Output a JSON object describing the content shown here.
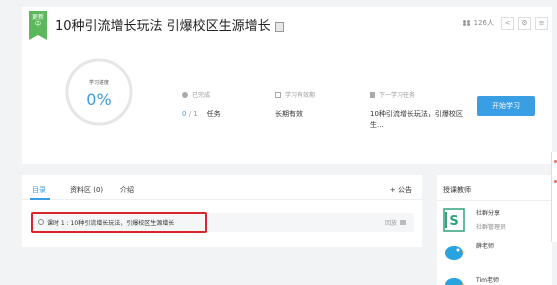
{
  "course": {
    "ribbon": [
      "更新",
      "中"
    ],
    "title": "10种引流增长玩法 引爆校区生源增长",
    "people_count": "126人",
    "actions": [
      "share-icon",
      "settings-icon",
      "menu-icon"
    ]
  },
  "progress": {
    "label": "学习进度",
    "value": "0%",
    "fraction": 0
  },
  "stats": {
    "completed_head": "已完成",
    "completed_done": "0",
    "completed_total": "/ 1",
    "completed_unit": "任务",
    "validity_head": "学习有效期",
    "validity_value": "长期有效",
    "next_head": "下一学习任务",
    "next_value": "10种引流增长玩法，引爆校区生..."
  },
  "start_button": "开始学习",
  "tabs": {
    "items": [
      "目录",
      "资料区 (0)",
      "介绍"
    ],
    "notice": "+ 公告"
  },
  "lesson": {
    "text": "课时 1 : 10种引流增长玩法，引爆校区生源增长",
    "replay": "回放"
  },
  "teachers": {
    "heading": "授课教师",
    "list": [
      {
        "name": "社群分享",
        "role": "社群管理员"
      },
      {
        "name": "薛老师",
        "role": ""
      },
      {
        "name": "Tim老师",
        "role": ""
      }
    ]
  },
  "colors": {
    "accent": "#3a9ee4",
    "ribbon": "#5cb85c",
    "highlight": "#d9262b"
  }
}
